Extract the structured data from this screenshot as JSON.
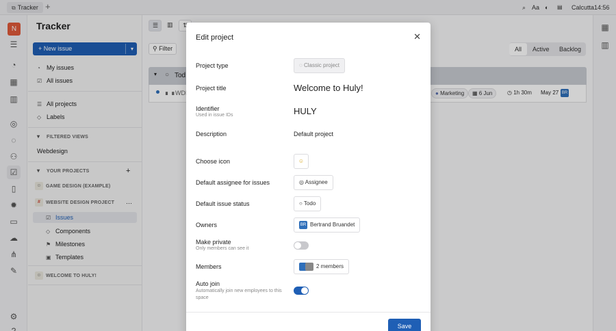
{
  "topbar": {
    "tab_label": "Tracker",
    "font_label": "Aa",
    "location": "Calcutta",
    "time": "14:56"
  },
  "nav": {
    "title": "Tracker",
    "new_issue": "New issue",
    "my_issues": "My issues",
    "all_issues": "All issues",
    "all_projects": "All projects",
    "labels": "Labels",
    "filtered_views": "FILTERED VIEWS",
    "webdesign": "Webdesign",
    "your_projects": "YOUR PROJECTS",
    "game_design": "GAME DESIGN (EXAMPLE)",
    "website_design": "WEBSITE DESIGN PROJECT",
    "issues": "Issues",
    "components": "Components",
    "milestones": "Milestones",
    "templates": "Templates",
    "welcome": "WELCOME TO HULY!"
  },
  "main": {
    "filter": "Filter",
    "seg_all": "All",
    "seg_active": "Active",
    "seg_backlog": "Backlog",
    "group_label": "Tod",
    "issue_id": "WDF",
    "chip_marketing": "Marketing",
    "chip_date": "6 Jun",
    "chip_time": "1h 30m",
    "chip_mod": "May 27",
    "avatar": "BR"
  },
  "modal": {
    "title": "Edit project",
    "project_type_label": "Project type",
    "project_type_value": "Classic project",
    "project_title_label": "Project title",
    "project_title_value": "Welcome to Huly!",
    "identifier_label": "Identifier",
    "identifier_sub": "Used in issue IDs",
    "identifier_value": "HULY",
    "description_label": "Description",
    "description_value": "Default project",
    "icon_label": "Choose icon",
    "assignee_label": "Default assignee for issues",
    "assignee_value": "Assignee",
    "status_label": "Default issue status",
    "status_value": "Todo",
    "owners_label": "Owners",
    "owners_value": "Bertrand Bruandet",
    "owners_avatar": "BR",
    "private_label": "Make private",
    "private_sub": "Only members can see it",
    "private_on": false,
    "members_label": "Members",
    "members_value": "2 members",
    "autojoin_label": "Auto join",
    "autojoin_sub": "Automatically join new employees to this space",
    "autojoin_on": true,
    "save_label": "Save"
  }
}
